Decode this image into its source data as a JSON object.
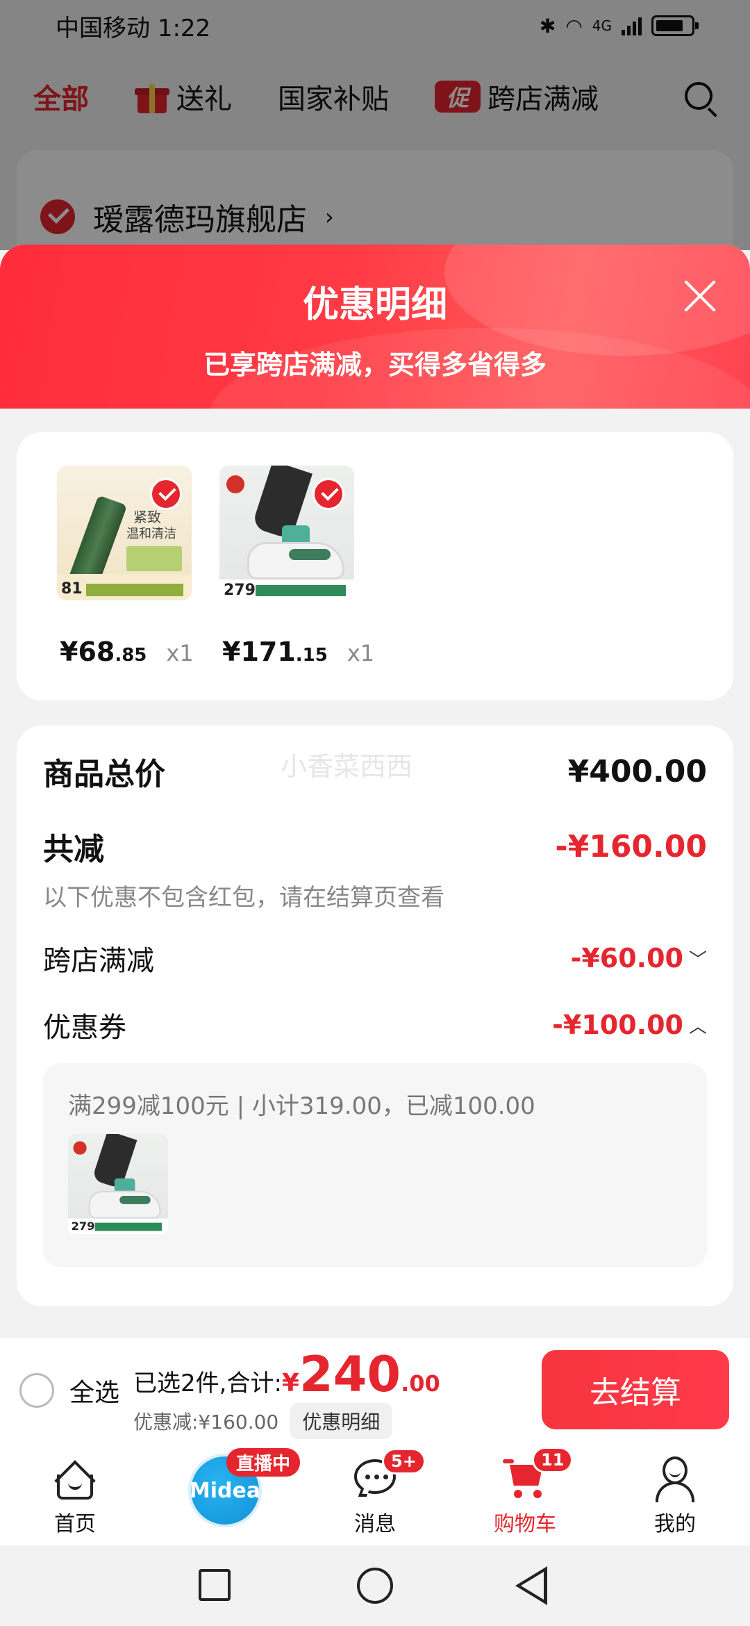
{
  "status_bar": {
    "carrier": "中国移动",
    "time": "1:22",
    "network": "4G"
  },
  "top_tabs": [
    {
      "label": "全部",
      "active": true
    },
    {
      "label": "送礼",
      "icon": "gift-icon"
    },
    {
      "label": "国家补贴"
    },
    {
      "label": "跨店满减",
      "badge": "促"
    }
  ],
  "store": {
    "name": "瑷露德玛旗舰店",
    "chevron": "›"
  },
  "sheet": {
    "title": "优惠明细",
    "subtitle": "已享跨店满减，买得多省得多",
    "products": [
      {
        "name": "cream-product",
        "thumb_price": "81",
        "price_int": "¥68",
        "price_dec": ".85",
        "qty": "x1"
      },
      {
        "name": "shoe-product",
        "thumb_price": "279",
        "price_int": "¥171",
        "price_dec": ".15",
        "qty": "x1"
      }
    ],
    "thumb_texts": {
      "line1": "紧致",
      "line2": "温和清洁"
    },
    "summary": {
      "watermark": "小香菜西西",
      "total_label": "商品总价",
      "total_value": "¥400.00",
      "reduce_label": "共减",
      "reduce_value": "-¥160.00",
      "note": "以下优惠不包含红包，请在结算页查看",
      "cross_store_label": "跨店满减",
      "cross_store_value": "-¥60.00",
      "coupon_label": "优惠券",
      "coupon_value": "-¥100.00",
      "coupon_detail": "满299减100元 | 小计319.00，已减100.00",
      "coupon_thumb_price": "279"
    }
  },
  "checkout": {
    "select_all": "全选",
    "selected_prefix": "已选2件,合计:",
    "currency": "¥",
    "total_int": "240",
    "total_dec": ".00",
    "discount_text": "优惠减:¥160.00",
    "detail_chip": "优惠明细",
    "button": "去结算"
  },
  "bottom_nav": [
    {
      "label": "首页",
      "icon": "home-icon"
    },
    {
      "label": "",
      "icon": "midea-logo",
      "logo_text": "Midea",
      "badge": "直播中"
    },
    {
      "label": "消息",
      "icon": "message-icon",
      "badge": "5+"
    },
    {
      "label": "购物车",
      "icon": "cart-icon",
      "badge": "11",
      "active": true
    },
    {
      "label": "我的",
      "icon": "profile-icon"
    }
  ],
  "colors": {
    "accent_red": "#e5262e",
    "header_gradient_start": "#ff2c3c",
    "header_gradient_end": "#ff4350"
  }
}
